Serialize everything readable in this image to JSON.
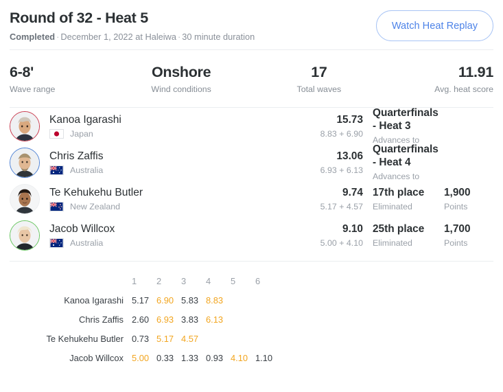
{
  "header": {
    "title": "Round of 32 - Heat 5",
    "status": "Completed",
    "sep1": "·",
    "date_location": "December 1, 2022 at Haleiwa",
    "sep2": "·",
    "duration": "30 minute duration",
    "replay_button": "Watch Heat Replay",
    "accent_color": "#4d83e8",
    "replay_border_color": "#a8c4f5"
  },
  "stats": [
    {
      "value": "6-8'",
      "label": "Wave range"
    },
    {
      "value": "Onshore",
      "label": "Wind conditions"
    },
    {
      "value": "17",
      "label": "Total waves"
    },
    {
      "value": "11.91",
      "label": "Avg. heat score"
    }
  ],
  "athletes": [
    {
      "name": "Kanoa Igarashi",
      "country": "Japan",
      "flag": "japan-flag",
      "jersey_color": "#c8374b",
      "score": "15.73",
      "score_breakdown": "8.83 + 6.90",
      "result": "Quarterfinals - Heat 3",
      "result_sub": "Advances to",
      "points": "",
      "points_label": ""
    },
    {
      "name": "Chris Zaffis",
      "country": "Australia",
      "flag": "australia-flag",
      "jersey_color": "#4a7fd4",
      "score": "13.06",
      "score_breakdown": "6.93 + 6.13",
      "result": "Quarterfinals - Heat 4",
      "result_sub": "Advances to",
      "points": "",
      "points_label": ""
    },
    {
      "name": "Te Kehukehu Butler",
      "country": "New Zealand",
      "flag": "newzealand-flag",
      "jersey_color": "#eceef0",
      "score": "9.74",
      "score_breakdown": "5.17 + 4.57",
      "result": "17th place",
      "result_sub": "Eliminated",
      "points": "1,900",
      "points_label": "Points"
    },
    {
      "name": "Jacob Willcox",
      "country": "Australia",
      "flag": "australia-flag",
      "jersey_color": "#62c45a",
      "score": "9.10",
      "score_breakdown": "5.00 + 4.10",
      "result": "25th place",
      "result_sub": "Eliminated",
      "points": "1,700",
      "points_label": "Points"
    }
  ],
  "wave_table": {
    "counted_color": "#f2a51f",
    "columns": [
      "1",
      "2",
      "3",
      "4",
      "5",
      "6"
    ],
    "rows": [
      {
        "name": "Kanoa Igarashi",
        "scores": [
          "5.17",
          "6.90",
          "5.83",
          "8.83",
          "",
          ""
        ],
        "counted": [
          false,
          true,
          false,
          true,
          false,
          false
        ]
      },
      {
        "name": "Chris Zaffis",
        "scores": [
          "2.60",
          "6.93",
          "3.83",
          "6.13",
          "",
          ""
        ],
        "counted": [
          false,
          true,
          false,
          true,
          false,
          false
        ]
      },
      {
        "name": "Te Kehukehu Butler",
        "scores": [
          "0.73",
          "5.17",
          "4.57",
          "",
          "",
          ""
        ],
        "counted": [
          false,
          true,
          true,
          false,
          false,
          false
        ]
      },
      {
        "name": "Jacob Willcox",
        "scores": [
          "5.00",
          "0.33",
          "1.33",
          "0.93",
          "4.10",
          "1.10"
        ],
        "counted": [
          true,
          false,
          false,
          false,
          true,
          false
        ]
      }
    ]
  }
}
